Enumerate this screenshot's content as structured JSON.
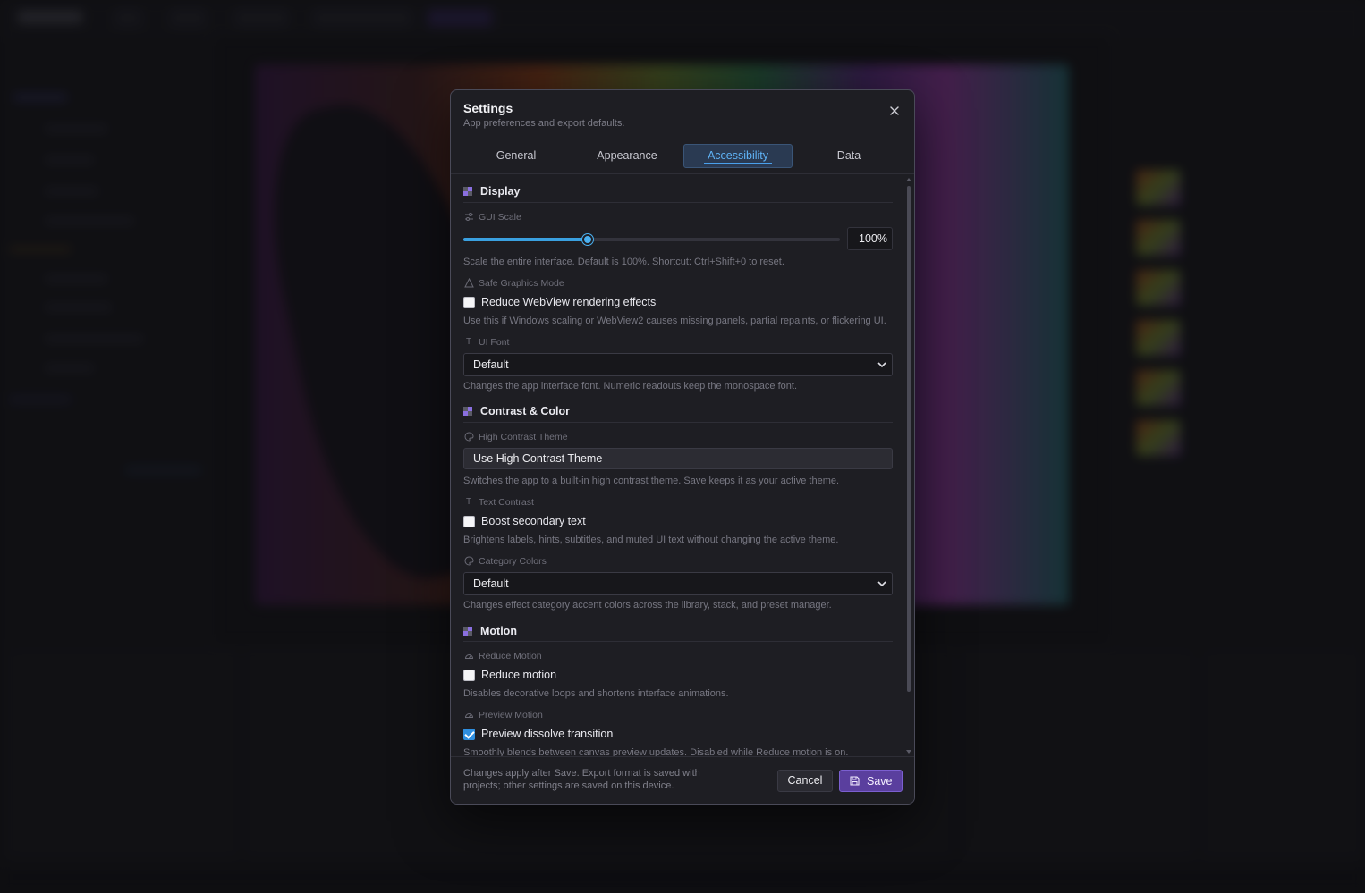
{
  "modal": {
    "title": "Settings",
    "subtitle": "App preferences and export defaults."
  },
  "tabs": [
    {
      "label": "General",
      "active": false
    },
    {
      "label": "Appearance",
      "active": false
    },
    {
      "label": "Accessibility",
      "active": true
    },
    {
      "label": "Data",
      "active": false
    }
  ],
  "display": {
    "title": "Display",
    "gui_scale": {
      "label": "GUI Scale",
      "value": "100%",
      "slider_fraction": 0.33,
      "hint": "Scale the entire interface. Default is 100%. Shortcut: Ctrl+Shift+0 to reset."
    },
    "safe_graphics": {
      "label": "Safe Graphics Mode",
      "checkbox_label": "Reduce WebView rendering effects",
      "checked": false,
      "hint": "Use this if Windows scaling or WebView2 causes missing panels, partial repaints, or flickering UI."
    },
    "ui_font": {
      "label": "UI Font",
      "value": "Default",
      "hint": "Changes the app interface font. Numeric readouts keep the monospace font."
    }
  },
  "contrast": {
    "title": "Contrast & Color",
    "high_contrast": {
      "label": "High Contrast Theme",
      "button_label": "Use High Contrast Theme",
      "hint": "Switches the app to a built-in high contrast theme. Save keeps it as your active theme."
    },
    "text_contrast": {
      "label": "Text Contrast",
      "checkbox_label": "Boost secondary text",
      "checked": false,
      "hint": "Brightens labels, hints, subtitles, and muted UI text without changing the active theme."
    },
    "category_colors": {
      "label": "Category Colors",
      "value": "Default",
      "hint": "Changes effect category accent colors across the library, stack, and preset manager."
    }
  },
  "motion": {
    "title": "Motion",
    "reduce_motion": {
      "label": "Reduce Motion",
      "checkbox_label": "Reduce motion",
      "checked": false,
      "hint": "Disables decorative loops and shortens interface animations."
    },
    "preview_motion": {
      "label": "Preview Motion",
      "checkbox_label": "Preview dissolve transition",
      "checked": true,
      "hint": "Smoothly blends between canvas preview updates. Disabled while Reduce motion is on."
    }
  },
  "footer": {
    "note": "Changes apply after Save. Export format is saved with projects; other settings are saved on this device.",
    "cancel_label": "Cancel",
    "save_label": "Save"
  },
  "colors": {
    "accent": "#4aa0ec",
    "save_button": "#5a3f9e",
    "section_icon_primary": "#8a6fe0",
    "section_icon_secondary": "#5a5a66"
  },
  "icons": {
    "close": "close-icon",
    "gui_scale": "sliders-icon",
    "safe_graphics": "warning-triangle-icon",
    "ui_font": "text-type-icon",
    "high_contrast": "palette-icon",
    "text_contrast": "text-type-icon",
    "category_colors": "palette-icon",
    "reduce_motion": "gauge-icon",
    "preview_motion": "gauge-icon",
    "save": "save-floppy-icon"
  }
}
